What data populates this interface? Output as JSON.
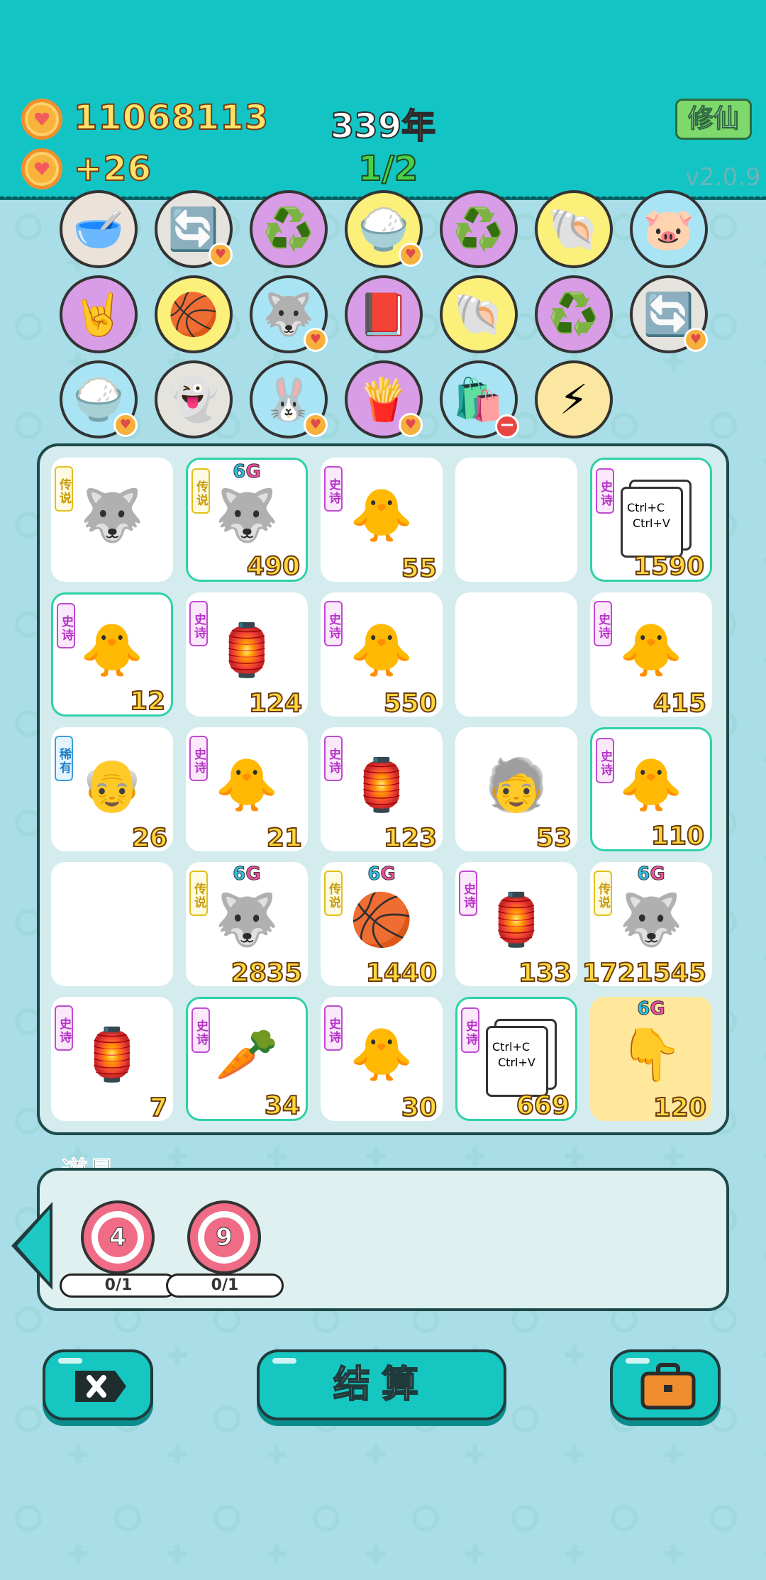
{
  "header": {
    "coins": "11068113",
    "income": "+26",
    "year": "339年",
    "page": "1/2",
    "cultivate_label": "修仙",
    "version": "v2.0.9"
  },
  "item_rows": [
    [
      {
        "icon": "food-bowl-icon",
        "glyph": "🥣",
        "bg": "#ebe3d9",
        "heart": false
      },
      {
        "icon": "refresh-icon",
        "glyph": "🔄",
        "bg": "#e5e3dd",
        "heart": true
      },
      {
        "icon": "recycle-icon",
        "glyph": "♻️",
        "bg": "#d89de6",
        "heart": false
      },
      {
        "icon": "rice-bowl-icon",
        "glyph": "🍚",
        "bg": "#fbf07a",
        "heart": true
      },
      {
        "icon": "recycle-icon",
        "glyph": "♻️",
        "bg": "#d89de6",
        "heart": false
      },
      {
        "icon": "shell-icon",
        "glyph": "🐚",
        "bg": "#fbf07a",
        "heart": false
      },
      {
        "icon": "piggy-bank-icon",
        "glyph": "🐷",
        "bg": "#a9e4f4",
        "heart": false
      }
    ],
    [
      {
        "icon": "rock-hand-icon",
        "glyph": "🤘",
        "bg": "#d89de6",
        "heart": false
      },
      {
        "icon": "basketballs-icon",
        "glyph": "🏀",
        "bg": "#fbf07a",
        "heart": false
      },
      {
        "icon": "husky-icon",
        "glyph": "🐺",
        "bg": "#a9e4f4",
        "heart": true
      },
      {
        "icon": "time-magazine-icon",
        "glyph": "📕",
        "bg": "#d89de6",
        "heart": false
      },
      {
        "icon": "shell-icon",
        "glyph": "🐚",
        "bg": "#fbf07a",
        "heart": false
      },
      {
        "icon": "recycle-icon",
        "glyph": "♻️",
        "bg": "#d89de6",
        "heart": false
      },
      {
        "icon": "refresh-icon",
        "glyph": "🔄",
        "bg": "#e5e3dd",
        "heart": true
      }
    ],
    [
      {
        "icon": "rice-bowl-icon",
        "glyph": "🍚",
        "bg": "#a9e4f4",
        "heart": true
      },
      {
        "icon": "ghost-icon",
        "glyph": "👻",
        "bg": "#e5e3dd",
        "heart": false
      },
      {
        "icon": "rabbit-icon",
        "glyph": "🐰",
        "bg": "#a9e4f4",
        "heart": true
      },
      {
        "icon": "fries-icon",
        "glyph": "🍟",
        "bg": "#d89de6",
        "heart": true
      },
      {
        "icon": "bag-icon",
        "glyph": "🛍️",
        "bg": "#a9e4f4",
        "heart": false,
        "minus": true
      },
      {
        "icon": "lightning-icon",
        "glyph": "⚡",
        "bg": "#fbe7a2",
        "heart": false
      }
    ]
  ],
  "board": [
    [
      {
        "tag": "传说",
        "tagType": "leg",
        "art": "husky-king",
        "glyph": "🐺",
        "count": "",
        "hl": false,
        "g6": false
      },
      {
        "tag": "传说",
        "tagType": "leg",
        "art": "husky-king",
        "glyph": "🐺",
        "count": "490",
        "hl": true,
        "g6": true
      },
      {
        "tag": "史诗",
        "tagType": "epic",
        "art": "chick",
        "glyph": "🐥",
        "count": "55",
        "hl": false,
        "g6": false
      },
      {
        "tag": "",
        "tagType": "",
        "art": "empty",
        "glyph": "",
        "count": "",
        "hl": false,
        "g6": false
      },
      {
        "tag": "史诗",
        "tagType": "epic",
        "art": "ctrl-cv",
        "glyph": "",
        "count": "1590",
        "hl": true,
        "g6": false
      }
    ],
    [
      {
        "tag": "史诗",
        "tagType": "epic",
        "art": "chick",
        "glyph": "🐥",
        "count": "12",
        "hl": true,
        "g6": false
      },
      {
        "tag": "史诗",
        "tagType": "epic",
        "art": "rabbit-house",
        "glyph": "🏮",
        "count": "124",
        "hl": false,
        "g6": false
      },
      {
        "tag": "史诗",
        "tagType": "epic",
        "art": "chick",
        "glyph": "🐥",
        "count": "550",
        "hl": false,
        "g6": false
      },
      {
        "tag": "",
        "tagType": "",
        "art": "empty",
        "glyph": "",
        "count": "",
        "hl": false,
        "g6": false
      },
      {
        "tag": "史诗",
        "tagType": "epic",
        "art": "chick",
        "glyph": "🐥",
        "count": "415",
        "hl": false,
        "g6": false
      }
    ],
    [
      {
        "tag": "稀有",
        "tagType": "rare",
        "art": "old-man",
        "glyph": "👴",
        "count": "26",
        "hl": false,
        "g6": false
      },
      {
        "tag": "史诗",
        "tagType": "epic",
        "art": "chick",
        "glyph": "🐥",
        "count": "21",
        "hl": false,
        "g6": false
      },
      {
        "tag": "史诗",
        "tagType": "epic",
        "art": "rabbit-house",
        "glyph": "🏮",
        "count": "123",
        "hl": false,
        "g6": false
      },
      {
        "tag": "",
        "tagType": "",
        "art": "old-man-glasses",
        "glyph": "🧓",
        "count": "53",
        "hl": false,
        "g6": false
      },
      {
        "tag": "史诗",
        "tagType": "epic",
        "art": "chick",
        "glyph": "🐥",
        "count": "110",
        "hl": true,
        "g6": false
      }
    ],
    [
      {
        "tag": "",
        "tagType": "",
        "art": "empty",
        "glyph": "",
        "count": "",
        "hl": false,
        "g6": false
      },
      {
        "tag": "传说",
        "tagType": "leg",
        "art": "husky-ball",
        "glyph": "🐺",
        "count": "2835",
        "hl": false,
        "g6": true
      },
      {
        "tag": "传说",
        "tagType": "leg",
        "art": "old-man-ball",
        "glyph": "🏀",
        "count": "1440",
        "hl": false,
        "g6": true
      },
      {
        "tag": "史诗",
        "tagType": "epic",
        "art": "rabbit-house",
        "glyph": "🏮",
        "count": "133",
        "hl": false,
        "g6": false
      },
      {
        "tag": "传说",
        "tagType": "leg",
        "art": "husky-king",
        "glyph": "🐺",
        "count": "1721545",
        "hl": false,
        "g6": true
      }
    ],
    [
      {
        "tag": "史诗",
        "tagType": "epic",
        "art": "rabbit-house",
        "glyph": "🏮",
        "count": "7",
        "hl": false,
        "g6": false
      },
      {
        "tag": "史诗",
        "tagType": "epic",
        "art": "carrot-crown",
        "glyph": "🥕",
        "count": "34",
        "hl": true,
        "g6": false
      },
      {
        "tag": "史诗",
        "tagType": "epic",
        "art": "chick",
        "glyph": "🐥",
        "count": "30",
        "hl": false,
        "g6": false
      },
      {
        "tag": "史诗",
        "tagType": "epic",
        "art": "ctrl-cv",
        "glyph": "",
        "count": "669",
        "hl": true,
        "g6": false
      },
      {
        "tag": "",
        "tagType": "",
        "art": "pointing-hand",
        "glyph": "👇",
        "count": "120",
        "hl": false,
        "g6": true,
        "gold": true
      }
    ]
  ],
  "ctrl_text": {
    "line1": "Ctrl+C",
    "line2": "Ctrl+V"
  },
  "g6_text": {
    "a": "6",
    "b": "G"
  },
  "tools": {
    "title": "道具",
    "items": [
      {
        "number": "4",
        "count": "0/1"
      },
      {
        "number": "9",
        "count": "0/1"
      }
    ]
  },
  "buttons": {
    "close_icon": "close-tag-icon",
    "settle_label": "结算",
    "bag_icon": "briefcase-icon"
  }
}
